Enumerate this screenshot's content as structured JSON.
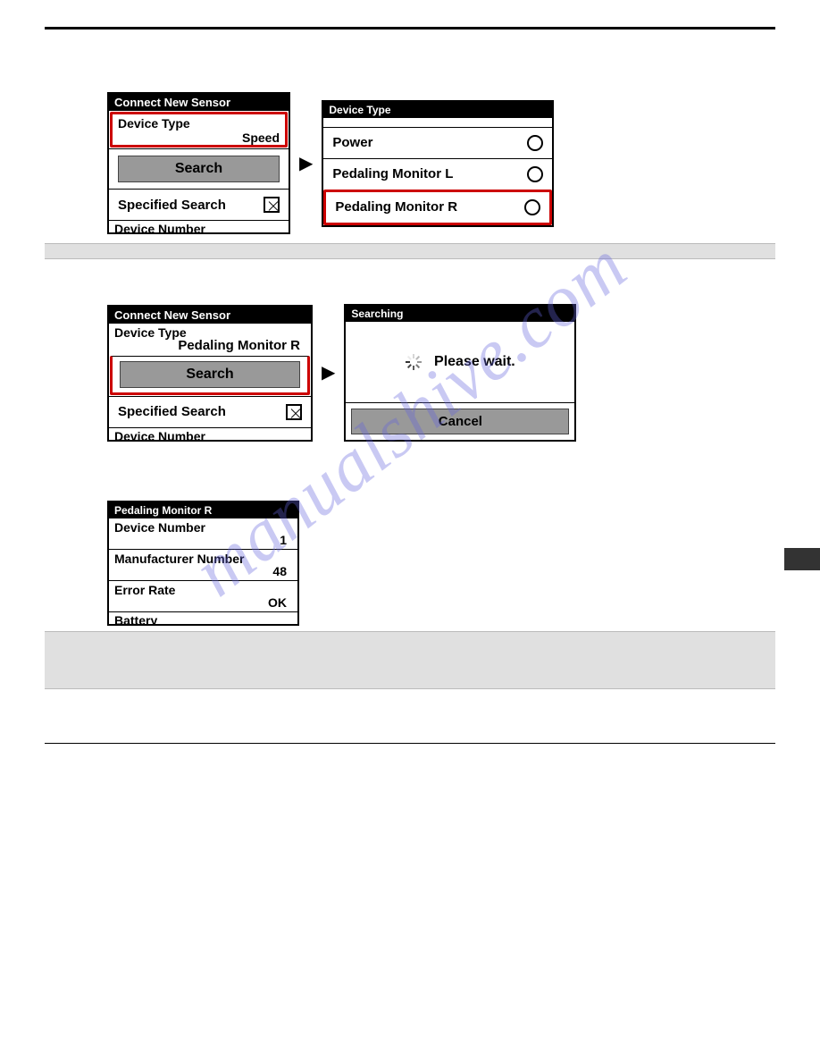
{
  "watermark": "manualshive.com",
  "step1": {
    "left": {
      "title": "Connect New Sensor",
      "device_type_label": "Device Type",
      "device_type_value": "Speed",
      "search_btn": "Search",
      "specified_search": "Specified Search",
      "partial": "Device Number"
    },
    "right": {
      "title": "Device Type",
      "options": [
        "Power",
        "Pedaling Monitor L",
        "Pedaling Monitor R"
      ]
    }
  },
  "step2": {
    "left": {
      "title": "Connect New Sensor",
      "device_type_label": "Device Type",
      "device_type_value": "Pedaling Monitor R",
      "search_btn": "Search",
      "specified_search": "Specified Search",
      "partial": "Device Number"
    },
    "right": {
      "title": "Searching",
      "wait_text": "Please wait.",
      "cancel_btn": "Cancel"
    }
  },
  "step3": {
    "title": "Pedaling Monitor R",
    "rows": [
      {
        "label": "Device Number",
        "value": "1"
      },
      {
        "label": "Manufacturer Number",
        "value": "48"
      },
      {
        "label": "Error Rate",
        "value": "OK"
      }
    ],
    "partial": "Battery"
  }
}
